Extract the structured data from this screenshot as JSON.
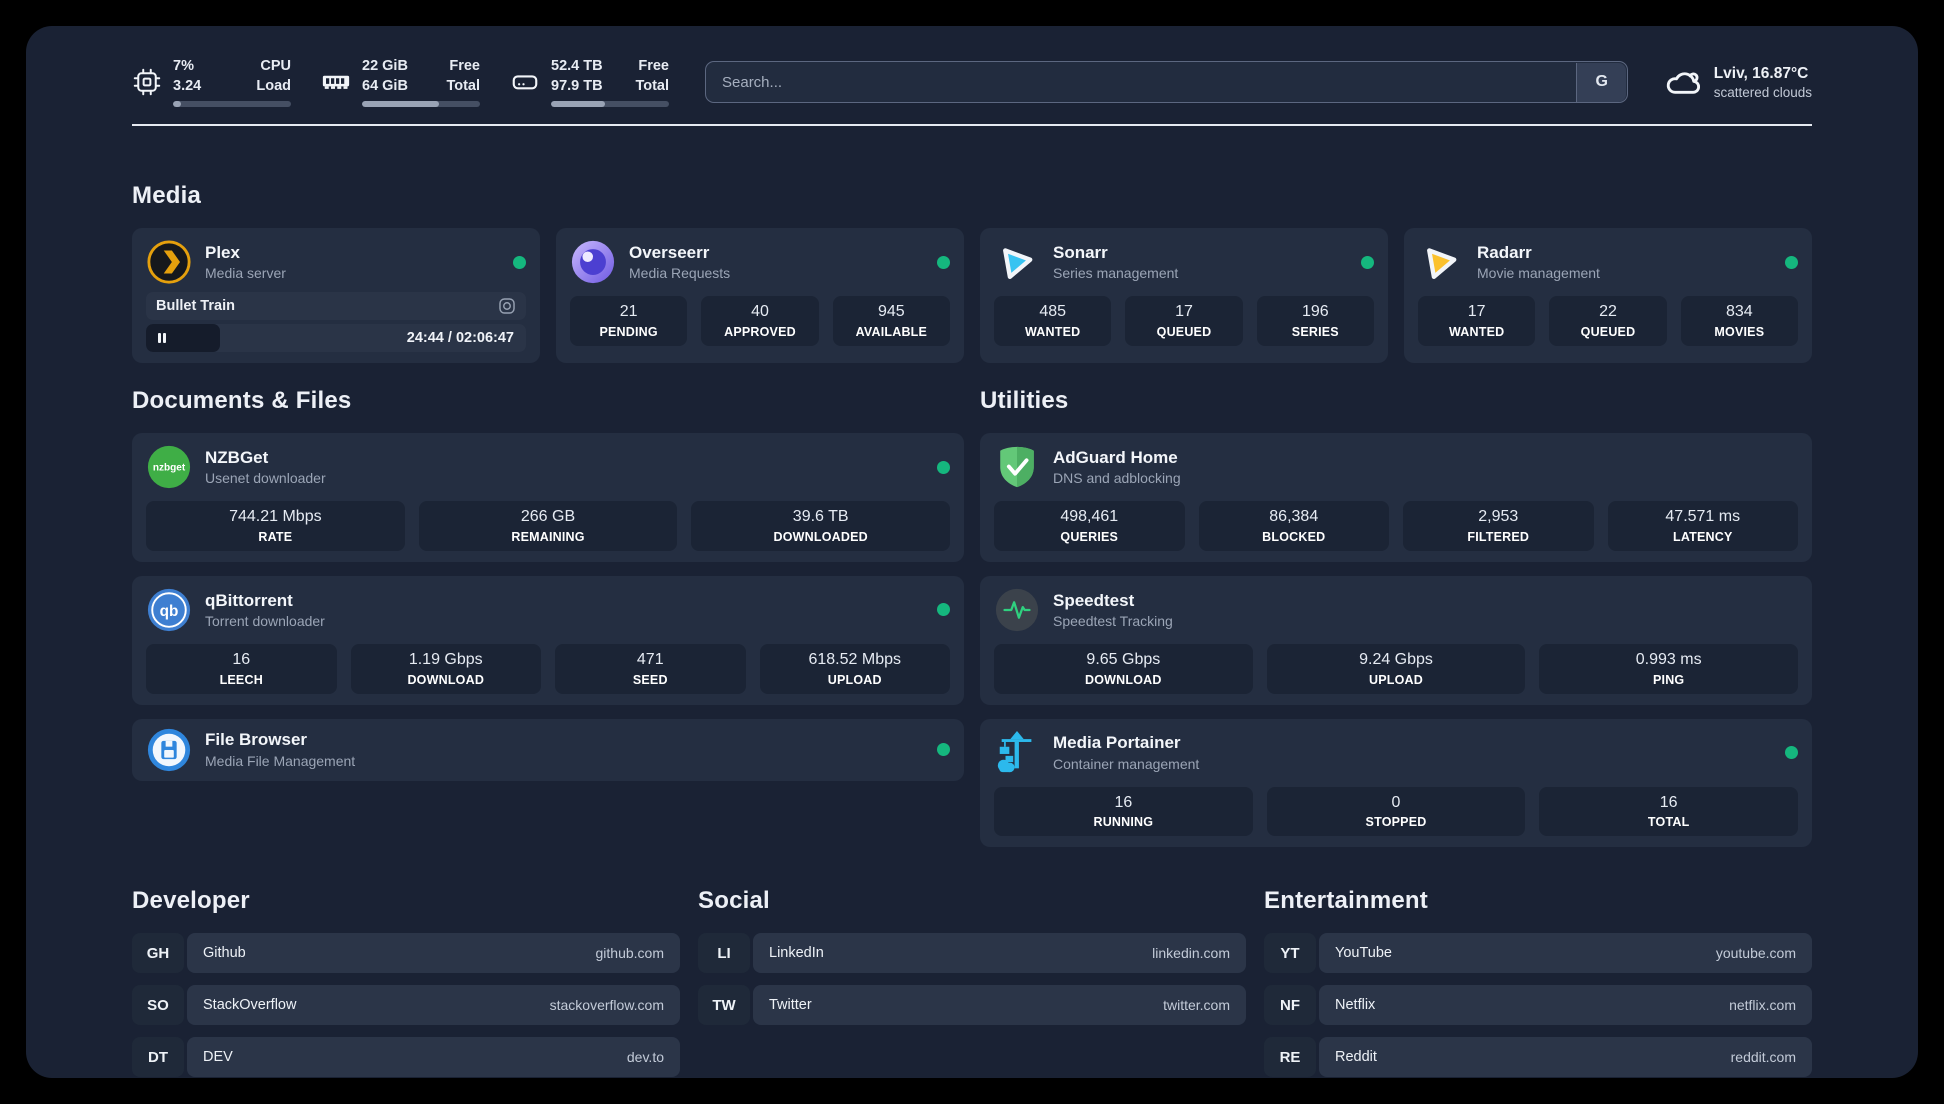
{
  "theme": {
    "status_online": "#15b77e",
    "accent_plex": "#e5a00d"
  },
  "header": {
    "stats": [
      {
        "icon": "cpu-icon",
        "value_top": "7%",
        "value_bottom": "3.24",
        "label_top": "CPU",
        "label_bottom": "Load",
        "progress": 7
      },
      {
        "icon": "memory-icon",
        "value_top": "22 GiB",
        "value_bottom": "64 GiB",
        "label_top": "Free",
        "label_bottom": "Total",
        "progress": 65
      },
      {
        "icon": "disk-icon",
        "value_top": "52.4 TB",
        "value_bottom": "97.9 TB",
        "label_top": "Free",
        "label_bottom": "Total",
        "progress": 46
      }
    ],
    "search": {
      "placeholder": "Search...",
      "engine_button": "G"
    },
    "weather": {
      "location_temp": "Lviv, 16.87°C",
      "condition": "scattered clouds"
    }
  },
  "icons": {
    "nzbget_logo_text": "nzbget",
    "qbittorrent_logo_text": "qb"
  },
  "sections": {
    "media": {
      "title": "Media",
      "apps": [
        {
          "name": "Plex",
          "subtitle": "Media server",
          "status": "online",
          "player": {
            "track": "Bullet Train",
            "time": "24:44 / 02:06:47",
            "progress_pct": 19.5
          }
        },
        {
          "name": "Overseerr",
          "subtitle": "Media Requests",
          "status": "online",
          "stats": [
            {
              "value": "21",
              "label": "PENDING"
            },
            {
              "value": "40",
              "label": "APPROVED"
            },
            {
              "value": "945",
              "label": "AVAILABLE"
            }
          ]
        },
        {
          "name": "Sonarr",
          "subtitle": "Series management",
          "status": "online",
          "stats": [
            {
              "value": "485",
              "label": "WANTED"
            },
            {
              "value": "17",
              "label": "QUEUED"
            },
            {
              "value": "196",
              "label": "SERIES"
            }
          ]
        },
        {
          "name": "Radarr",
          "subtitle": "Movie management",
          "status": "online",
          "stats": [
            {
              "value": "17",
              "label": "WANTED"
            },
            {
              "value": "22",
              "label": "QUEUED"
            },
            {
              "value": "834",
              "label": "MOVIES"
            }
          ]
        }
      ]
    },
    "documents": {
      "title": "Documents & Files",
      "apps": [
        {
          "name": "NZBGet",
          "subtitle": "Usenet downloader",
          "status": "online",
          "stats": [
            {
              "value": "744.21 Mbps",
              "label": "RATE"
            },
            {
              "value": "266 GB",
              "label": "REMAINING"
            },
            {
              "value": "39.6 TB",
              "label": "DOWNLOADED"
            }
          ]
        },
        {
          "name": "qBittorrent",
          "subtitle": "Torrent downloader",
          "status": "online",
          "stats": [
            {
              "value": "16",
              "label": "LEECH"
            },
            {
              "value": "1.19 Gbps",
              "label": "DOWNLOAD"
            },
            {
              "value": "471",
              "label": "SEED"
            },
            {
              "value": "618.52 Mbps",
              "label": "UPLOAD"
            }
          ]
        },
        {
          "name": "File Browser",
          "subtitle": "Media File Management",
          "status": "online",
          "stats": []
        }
      ]
    },
    "utilities": {
      "title": "Utilities",
      "apps": [
        {
          "name": "AdGuard Home",
          "subtitle": "DNS and adblocking",
          "stats": [
            {
              "value": "498,461",
              "label": "QUERIES"
            },
            {
              "value": "86,384",
              "label": "BLOCKED"
            },
            {
              "value": "2,953",
              "label": "FILTERED"
            },
            {
              "value": "47.571 ms",
              "label": "LATENCY"
            }
          ]
        },
        {
          "name": "Speedtest",
          "subtitle": "Speedtest Tracking",
          "stats": [
            {
              "value": "9.65 Gbps",
              "label": "DOWNLOAD"
            },
            {
              "value": "9.24 Gbps",
              "label": "UPLOAD"
            },
            {
              "value": "0.993 ms",
              "label": "PING"
            }
          ]
        },
        {
          "name": "Media Portainer",
          "subtitle": "Container management",
          "status": "online",
          "stats": [
            {
              "value": "16",
              "label": "RUNNING"
            },
            {
              "value": "0",
              "label": "STOPPED"
            },
            {
              "value": "16",
              "label": "TOTAL"
            }
          ]
        }
      ]
    },
    "links": [
      {
        "title": "Developer",
        "items": [
          {
            "abbr": "GH",
            "name": "Github",
            "url": "github.com"
          },
          {
            "abbr": "SO",
            "name": "StackOverflow",
            "url": "stackoverflow.com"
          },
          {
            "abbr": "DT",
            "name": "DEV",
            "url": "dev.to"
          }
        ]
      },
      {
        "title": "Social",
        "items": [
          {
            "abbr": "LI",
            "name": "LinkedIn",
            "url": "linkedin.com"
          },
          {
            "abbr": "TW",
            "name": "Twitter",
            "url": "twitter.com"
          }
        ]
      },
      {
        "title": "Entertainment",
        "items": [
          {
            "abbr": "YT",
            "name": "YouTube",
            "url": "youtube.com"
          },
          {
            "abbr": "NF",
            "name": "Netflix",
            "url": "netflix.com"
          },
          {
            "abbr": "RE",
            "name": "Reddit",
            "url": "reddit.com"
          }
        ]
      }
    ]
  }
}
